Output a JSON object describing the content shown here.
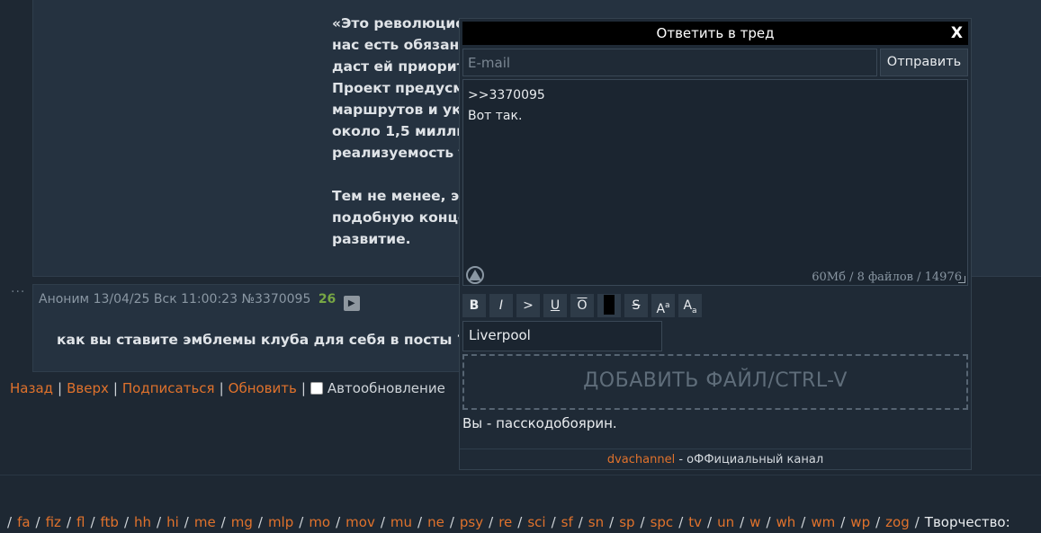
{
  "op_post": {
    "text": "«Это революционная инициатива, и мы очень довольны\nнас есть обязанность сохранить транспортную систему,\nдаст ей приоритет»,\nПроект предусматривает строительство здание 7 ки\nмаршрутов и уклонение от решения главного вопр\nоколо 1,5 миллиарда, что вызывает у них, сомне\nреализуемость такого\n\nТем не менее, эколог против сноса\nподобную концепцию ний и ори\nразвитие."
  },
  "reply_post": {
    "dots": "···",
    "author": "Аноним",
    "date": "13/04/25 Вск 11:00:23",
    "number": "№3370095",
    "reply_count": "26",
    "play_icon": "▶",
    "body": "как вы ставите эмблемы клуба для себя в посты ?"
  },
  "nav": {
    "back": "Назад",
    "top": "Вверх",
    "subscribe": "Подписаться",
    "refresh": "Обновить",
    "autorefresh": "Автообновление",
    "sep": "|"
  },
  "boards": {
    "items": [
      "fa",
      "fiz",
      "fl",
      "ftb",
      "hh",
      "hi",
      "me",
      "mg",
      "mlp",
      "mo",
      "mov",
      "mu",
      "ne",
      "psy",
      "re",
      "sci",
      "sf",
      "sn",
      "sp",
      "spc",
      "tv",
      "un",
      "w",
      "wh",
      "wm",
      "wp",
      "zog"
    ],
    "sep": "/",
    "section_label": "Творчество:"
  },
  "reply_form": {
    "title": "Ответить в тред",
    "close": "X",
    "email_placeholder": "E-mail",
    "send_label": "Отправить",
    "message": ">>3370095\nВот так.",
    "limits": "60Мб / 8 файлов / 14976",
    "toolbar": {
      "bold": "B",
      "italic": "I",
      "quote": ">",
      "underline": "U",
      "overline": "O",
      "strike": "S",
      "sup_base": "A",
      "sup_mark": "a",
      "sub_base": "A",
      "sub_mark": "a"
    },
    "subject": "Liverpool",
    "drop_label": "ДОБАВИТЬ ФАЙЛ/CTRL-V",
    "status": "Вы - пасскодобоярин.",
    "footer_link": "dvachannel",
    "footer_text": " - оФФициальный канал"
  },
  "colors": {
    "background": "#1e2833",
    "post_bg": "#253240",
    "link": "#e0722c",
    "count_green": "#77a644"
  }
}
